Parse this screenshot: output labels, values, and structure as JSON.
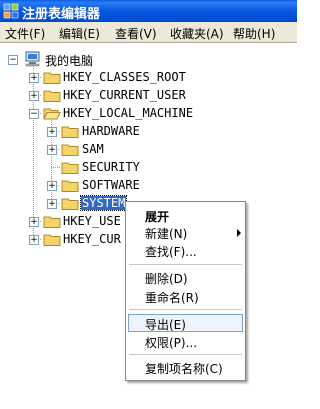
{
  "window": {
    "title": "注册表编辑器"
  },
  "menu": [
    "文件(F)",
    "编辑(E)",
    "查看(V)",
    "收藏夹(A)",
    "帮助(H)"
  ],
  "tree": {
    "root": "我的电脑",
    "hives": [
      {
        "label": "HKEY_CLASSES_ROOT",
        "expander": "+"
      },
      {
        "label": "HKEY_CURRENT_USER",
        "expander": "+"
      },
      {
        "label": "HKEY_LOCAL_MACHINE",
        "expander": "−"
      },
      {
        "label": "HKEY_USE",
        "expander": "+"
      },
      {
        "label": "HKEY_CUR",
        "expander": "+"
      }
    ],
    "hklm_children": [
      {
        "label": "HARDWARE",
        "expander": "+"
      },
      {
        "label": "SAM",
        "expander": "+"
      },
      {
        "label": "SECURITY",
        "expander": ""
      },
      {
        "label": "SOFTWARE",
        "expander": "+"
      },
      {
        "label": "SYSTEM",
        "expander": "+",
        "selected": true
      }
    ]
  },
  "context_menu": {
    "expand": "展开",
    "new": "新建(N)",
    "find": "查找(F)...",
    "delete": "删除(D)",
    "rename": "重命名(R)",
    "export": "导出(E)",
    "permissions": "权限(P)...",
    "copy_key_name": "复制项名称(C)"
  },
  "colors": {
    "titlebar": "#0049d4",
    "menubar": "#ece9d8",
    "folder": "#f5d36b",
    "selection": "#316ac5"
  },
  "icons": [
    "registry-app-icon",
    "computer-icon",
    "folder-icon",
    "submenu-arrow-icon"
  ]
}
